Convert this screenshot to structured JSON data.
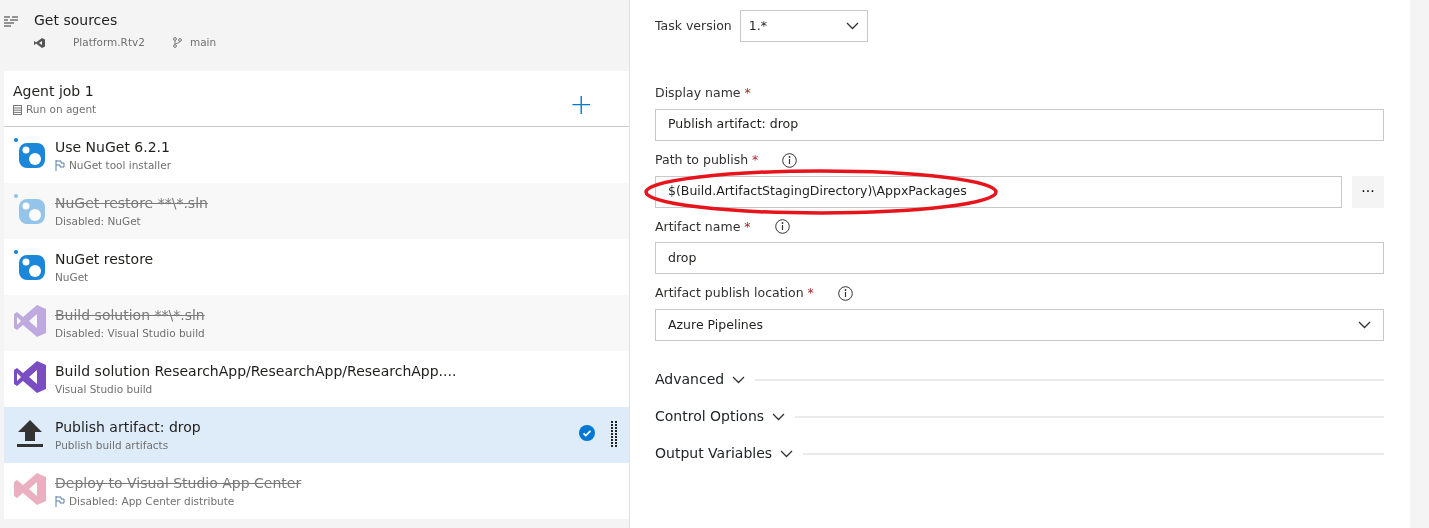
{
  "source": {
    "title": "Get sources",
    "repo": "Platform.Rtv2",
    "branch": "main"
  },
  "job": {
    "title": "Agent job 1",
    "subtitle": "Run on agent",
    "add": "+"
  },
  "tasks": [
    {
      "kind": "nuget",
      "name": "Use NuGet 6.2.1",
      "subtitle": "NuGet tool installer",
      "flag": true,
      "disabled": false,
      "selected": false
    },
    {
      "kind": "nuget",
      "name": "NuGet restore **\\*.sln",
      "subtitle": "Disabled: NuGet",
      "flag": false,
      "disabled": true,
      "selected": false
    },
    {
      "kind": "nuget",
      "name": "NuGet restore",
      "subtitle": "NuGet",
      "flag": false,
      "disabled": false,
      "selected": false
    },
    {
      "kind": "vs",
      "name": "Build solution **\\*.sln",
      "subtitle": "Disabled: Visual Studio build",
      "flag": false,
      "disabled": true,
      "selected": false
    },
    {
      "kind": "vs",
      "name": "Build solution ResearchApp/ResearchApp/ResearchApp....",
      "subtitle": "Visual Studio build",
      "flag": false,
      "disabled": false,
      "selected": false
    },
    {
      "kind": "upload",
      "name": "Publish artifact: drop",
      "subtitle": "Publish build artifacts",
      "flag": false,
      "disabled": false,
      "selected": true
    },
    {
      "kind": "appcenter",
      "name": "Deploy to Visual Studio App Center",
      "subtitle": "Disabled: App Center distribute",
      "flag": true,
      "disabled": true,
      "selected": false
    }
  ],
  "task_version": {
    "label": "Task version",
    "value": "1.*"
  },
  "fields": [
    {
      "kind": "text",
      "label": "Display name",
      "required": "*",
      "info": false,
      "value": "Publish artifact: drop",
      "browse": false,
      "highlighted": false
    },
    {
      "kind": "text",
      "label": "Path to publish",
      "required": "*",
      "info": true,
      "value": "$(Build.ArtifactStagingDirectory)\\AppxPackages",
      "browse": true,
      "browse_label": "···",
      "highlighted": true
    },
    {
      "kind": "text",
      "label": "Artifact name",
      "required": "*",
      "info": true,
      "value": "drop",
      "browse": false,
      "highlighted": false
    },
    {
      "kind": "select",
      "label": "Artifact publish location",
      "required": "*",
      "info": true,
      "value": "Azure Pipelines",
      "browse": false,
      "highlighted": false
    }
  ],
  "sections": [
    {
      "title": "Advanced",
      "expanded": false
    },
    {
      "title": "Control Options",
      "expanded": false
    },
    {
      "title": "Output Variables",
      "expanded": false
    }
  ]
}
